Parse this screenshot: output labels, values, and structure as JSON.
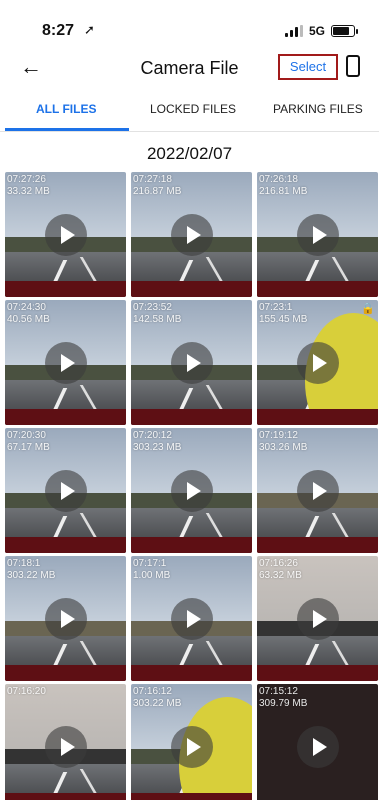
{
  "status_bar": {
    "time": "8:27",
    "location_arrow": "➚",
    "network": "5G"
  },
  "header": {
    "back_icon": "←",
    "title": "Camera File",
    "select_label": "Select"
  },
  "tabs": [
    {
      "label": "ALL FILES",
      "active": true
    },
    {
      "label": "LOCKED FILES",
      "active": false
    },
    {
      "label": "PARKING FILES",
      "active": false
    }
  ],
  "date_group": "2022/02/07",
  "files": [
    {
      "time": "07:27:26",
      "size": "33.32 MB",
      "locked": false
    },
    {
      "time": "07:27:18",
      "size": "216.87 MB",
      "locked": false
    },
    {
      "time": "07:26:18",
      "size": "216.81 MB",
      "locked": false
    },
    {
      "time": "07:24:30",
      "size": "40.56 MB",
      "locked": false
    },
    {
      "time": "07:23:52",
      "size": "142.58 MB",
      "locked": false
    },
    {
      "time": "07:23:1",
      "size": "155.45 MB",
      "locked": true
    },
    {
      "time": "07:20:30",
      "size": "67.17 MB",
      "locked": false
    },
    {
      "time": "07:20:12",
      "size": "303.23 MB",
      "locked": false
    },
    {
      "time": "07:19:12",
      "size": "303.26 MB",
      "locked": false
    },
    {
      "time": "07:18:1",
      "size": "303.22 MB",
      "locked": false
    },
    {
      "time": "07:17:1",
      "size": "1.00 MB",
      "locked": false
    },
    {
      "time": "07:16:26",
      "size": "63.32 MB",
      "locked": false
    },
    {
      "time": "07:16:20",
      "size": "",
      "locked": false
    },
    {
      "time": "07:16:12",
      "size": "303.22 MB",
      "locked": false
    },
    {
      "time": "07:15:12",
      "size": "309.79 MB",
      "locked": false
    }
  ]
}
